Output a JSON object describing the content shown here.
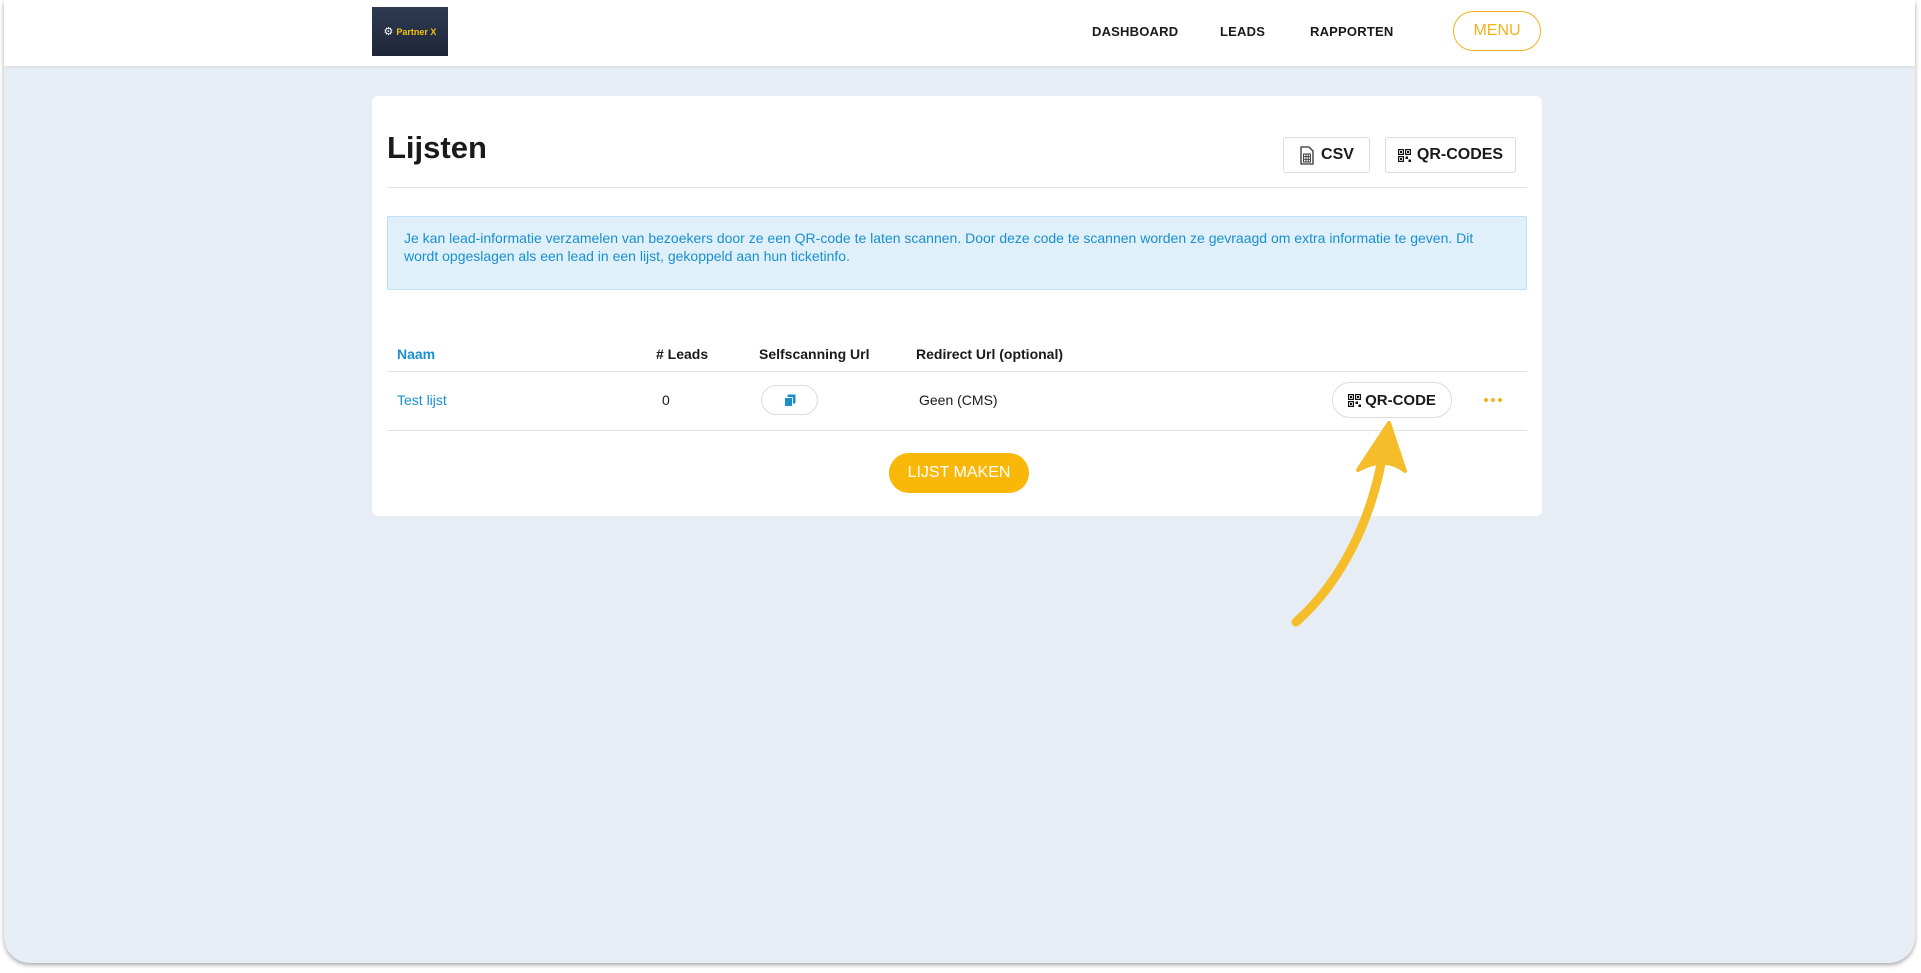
{
  "header": {
    "logo_text": "Partner X",
    "nav": [
      "DASHBOARD",
      "LEADS",
      "RAPPORTEN"
    ],
    "menu_label": "MENU"
  },
  "page": {
    "title": "Lijsten",
    "csv_label": "CSV",
    "qr_codes_label": "QR-CODES",
    "info_text": "Je kan lead-informatie verzamelen van bezoekers door ze een QR-code te laten scannen. Door deze code te scannen worden ze gevraagd om extra informatie te geven. Dit wordt opgeslagen als een lead in een lijst, gekoppeld aan hun ticketinfo."
  },
  "table": {
    "headers": [
      "Naam",
      "# Leads",
      "Selfscanning Url",
      "Redirect Url (optional)"
    ],
    "rows": [
      {
        "name": "Test lijst",
        "leads": "0",
        "redirect": "Geen (CMS)",
        "qr_label": "QR-CODE"
      }
    ]
  },
  "create_button": "LIJST MAKEN",
  "colors": {
    "accent": "#f9b707",
    "link": "#1a8fd0",
    "background": "#e7edf4"
  },
  "icons": [
    "gear-icon",
    "csv-file-icon",
    "qr-code-icon",
    "copy-icon",
    "more-dots-icon"
  ]
}
